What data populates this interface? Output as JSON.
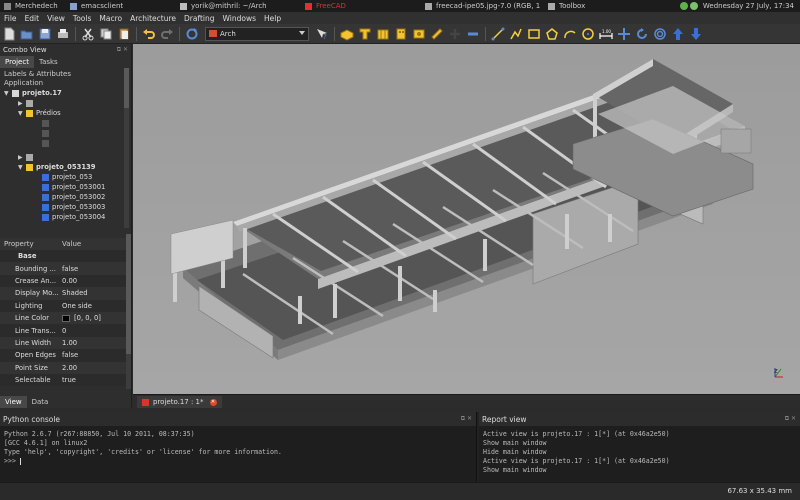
{
  "taskbar": {
    "tasks": [
      {
        "label": "Merchedech",
        "color": "#888888"
      },
      {
        "label": "emacsclient",
        "color": "#8aa0c8"
      },
      {
        "label": "yorik@mithril: ~/Arch",
        "color": "#bbbbbb"
      },
      {
        "label": "FreeCAD",
        "color": "#e03030"
      },
      {
        "label": "freecad-ipe05.jpg-7.0 (RGB, 1",
        "color": "#aaaaaa"
      },
      {
        "label": "Toolbox",
        "color": "#aaaaaa"
      }
    ],
    "clock": "Wednesday 27 July, 17:34"
  },
  "menubar": [
    "File",
    "Edit",
    "View",
    "Tools",
    "Macro",
    "Architecture",
    "Drafting",
    "Windows",
    "Help"
  ],
  "toolbar": {
    "workbench": "Arch",
    "icons": [
      "new-document-icon",
      "open-icon",
      "save-icon",
      "print-icon",
      "cut-icon",
      "copy-icon",
      "paste-icon",
      "undo-icon",
      "redo-icon",
      "refresh-icon",
      "whats-this-icon",
      "wall-icon",
      "structure-icon",
      "floor-icon",
      "building-icon",
      "site-icon",
      "window-icon",
      "add-icon",
      "remove-icon",
      "line-icon",
      "wire-icon",
      "rectangle-icon",
      "polygon-icon",
      "arc-icon",
      "circle-icon",
      "dimension-icon",
      "move-icon",
      "rotate-icon",
      "offset-icon",
      "upgrade-icon",
      "downgrade-icon"
    ]
  },
  "combo_view": {
    "title": "Combo View",
    "tabs": [
      "Project",
      "Tasks"
    ],
    "tree_header_1": "Labels & Attributes",
    "tree_header_2": "Application",
    "tree": [
      {
        "label": "projeto.17",
        "bold": true
      },
      {
        "label": "",
        "bold": false
      },
      {
        "label": "Prédios",
        "bold": false
      },
      {
        "label": "",
        "bold": false
      },
      {
        "label": "",
        "bold": false
      },
      {
        "label": "",
        "bold": false
      },
      {
        "label": "projeto_053139",
        "bold": true
      },
      {
        "label": "projeto_053",
        "bold": false
      },
      {
        "label": "projeto_053001",
        "bold": false
      },
      {
        "label": "projeto_053002",
        "bold": false
      },
      {
        "label": "projeto_053003",
        "bold": false
      },
      {
        "label": "projeto_053004",
        "bold": false
      }
    ],
    "property_header": {
      "col1": "Property",
      "col2": "Value"
    },
    "properties": [
      {
        "name": "Base",
        "value": "",
        "group": true
      },
      {
        "name": "Bounding ...",
        "value": "false"
      },
      {
        "name": "Crease An...",
        "value": "0.00"
      },
      {
        "name": "Display Mo...",
        "value": "Shaded"
      },
      {
        "name": "Lighting",
        "value": "One side"
      },
      {
        "name": "Line Color",
        "value": "[0, 0, 0]",
        "swatch": "#000000"
      },
      {
        "name": "Line Trans...",
        "value": "0"
      },
      {
        "name": "Line Width",
        "value": "1.00"
      },
      {
        "name": "Open Edges",
        "value": "false"
      },
      {
        "name": "Point Size",
        "value": "2.00"
      },
      {
        "name": "Selectable",
        "value": "true"
      }
    ],
    "bottom_tabs": [
      "View",
      "Data"
    ]
  },
  "document_tab": "projeto.17 : 1*",
  "python_console": {
    "title": "Python console",
    "lines": [
      "Python 2.6.7 (r267:88850, Jul 10 2011, 08:37:35)",
      "[GCC 4.6.1] on linux2",
      "Type 'help', 'copyright', 'credits' or 'license' for more information.",
      ">>> "
    ]
  },
  "report_view": {
    "title": "Report view",
    "lines": [
      "Active view is projeto.17 : 1[*] (at 0x46a2e50)",
      "Show main window",
      "Hide main window",
      "Active view is projeto.17 : 1[*] (at 0x46a2e50)",
      "Show main window"
    ]
  },
  "status": {
    "dimensions": "67.63 x 35.43 mm"
  },
  "axis_label": "z"
}
